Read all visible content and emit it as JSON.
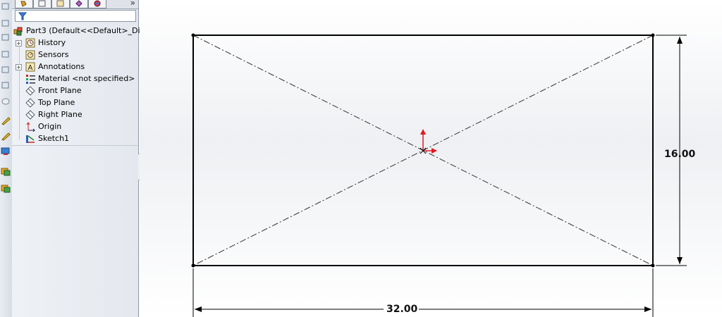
{
  "toolbar": {
    "more_label": "»"
  },
  "tree": {
    "root": "Part3  (Default<<Default>_Disp",
    "items": [
      {
        "label": "History",
        "icon": "history-icon"
      },
      {
        "label": "Sensors",
        "icon": "sensors-icon"
      },
      {
        "label": "Annotations",
        "icon": "annotations-icon"
      },
      {
        "label": "Material <not specified>",
        "icon": "material-icon"
      },
      {
        "label": "Front Plane",
        "icon": "plane-icon"
      },
      {
        "label": "Top Plane",
        "icon": "plane-icon"
      },
      {
        "label": "Right Plane",
        "icon": "plane-icon"
      },
      {
        "label": "Origin",
        "icon": "origin-icon"
      },
      {
        "label": "Sketch1",
        "icon": "sketch-icon"
      }
    ]
  },
  "sketch": {
    "width_dimension": "32.00",
    "height_dimension": "16.00"
  },
  "colors": {
    "origin_arrow": "#e0181e",
    "line": "#000000"
  }
}
